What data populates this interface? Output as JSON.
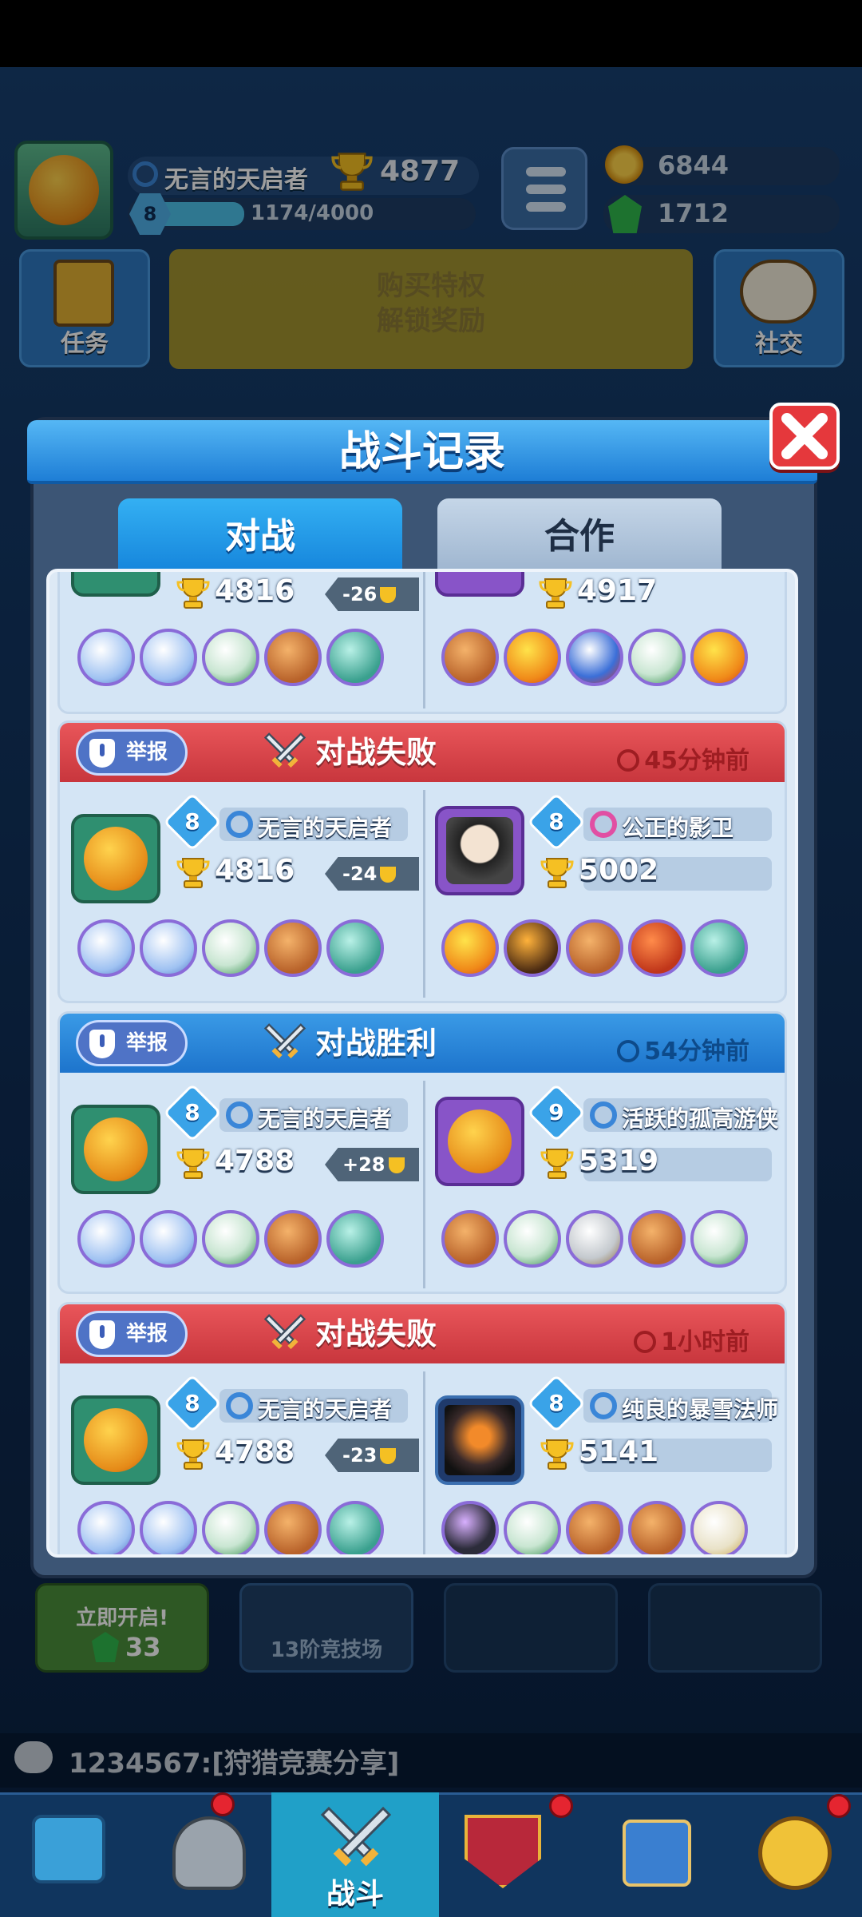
{
  "header": {
    "player_name": "无言的天启者",
    "trophies": "4877",
    "level": "8",
    "xp": "1174/4000",
    "xp_fraction": 0.29
  },
  "resources": {
    "gold": "6844",
    "gems": "1712"
  },
  "side_buttons": {
    "quests": "任务",
    "social": "社交"
  },
  "vip": {
    "line1": "购买特权",
    "line2": "解锁奖励"
  },
  "modal": {
    "title": "战斗记录",
    "tabs": [
      {
        "label": "对战",
        "active": true
      },
      {
        "label": "合作",
        "active": false
      }
    ],
    "report_label": "举报"
  },
  "records": [
    {
      "left": {
        "trophies": "4816",
        "delta": "-26"
      },
      "right": {
        "trophies": "4917"
      }
    },
    {
      "result": "对战失败",
      "time": "45分钟前",
      "left": {
        "level": "8",
        "name": "无言的天启者",
        "trophies": "4816",
        "delta": "-24"
      },
      "right": {
        "level": "8",
        "name": "公正的影卫",
        "trophies": "5002"
      }
    },
    {
      "result": "对战胜利",
      "time": "54分钟前",
      "left": {
        "level": "8",
        "name": "无言的天启者",
        "trophies": "4788",
        "delta": "+28"
      },
      "right": {
        "level": "9",
        "name": "活跃的孤高游侠",
        "trophies": "5319"
      }
    },
    {
      "result": "对战失败",
      "time": "1小时前",
      "left": {
        "level": "8",
        "name": "无言的天启者",
        "trophies": "4788",
        "delta": "-23"
      },
      "right": {
        "level": "8",
        "name": "纯良的暴雪法师",
        "trophies": "5141"
      }
    }
  ],
  "chests": {
    "open_now": "立即开启!",
    "open_cost": "33",
    "arena": "13阶竞技场"
  },
  "chat": {
    "message": "1234567:[狩猎竞赛分享]"
  },
  "nav": {
    "battle": "战斗"
  },
  "colors": {
    "loss": "#d8434a",
    "win": "#2a86dc",
    "modal_header": "#1e7ed6",
    "close": "#e5383c"
  }
}
